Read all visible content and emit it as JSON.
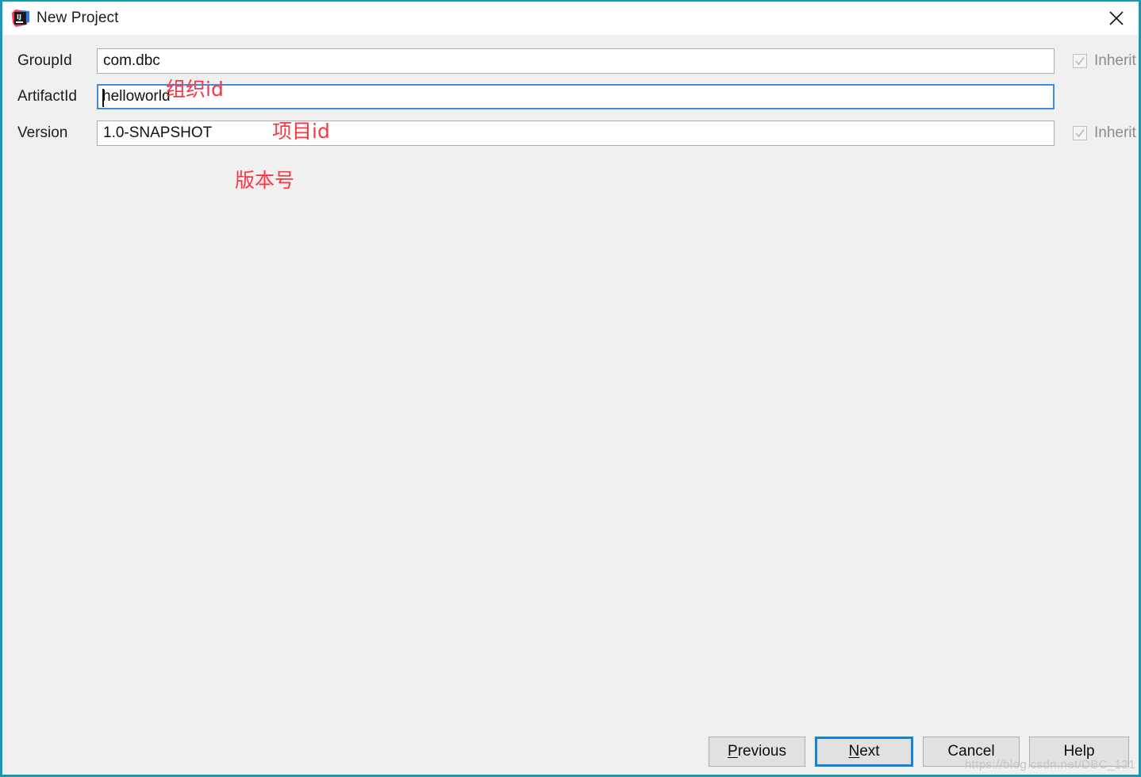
{
  "window": {
    "title": "New Project",
    "icon": "intellij-idea-icon",
    "close_icon": "close-icon",
    "border_color": "#1799b5",
    "titlebar_bg": "#ffffff",
    "content_bg": "#f0f0f0"
  },
  "form": {
    "rows": [
      {
        "label": "GroupId",
        "value": "com.dbc",
        "focused": false,
        "inherit": {
          "label": "Inherit",
          "checked": true,
          "enabled": false
        }
      },
      {
        "label": "ArtifactId",
        "value": "helloworld",
        "focused": true,
        "inherit": null
      },
      {
        "label": "Version",
        "value": "1.0-SNAPSHOT",
        "focused": false,
        "inherit": {
          "label": "Inherit",
          "checked": true,
          "enabled": false
        }
      }
    ]
  },
  "annotations": {
    "color": "#fb3640",
    "items": [
      {
        "text": "组织id",
        "target": "GroupId"
      },
      {
        "text": "项目id",
        "target": "ArtifactId"
      },
      {
        "text": "版本号",
        "target": "Version"
      }
    ]
  },
  "buttons": {
    "previous": {
      "label": "Previous",
      "mnemonic": "P",
      "default": false
    },
    "next": {
      "label": "Next",
      "mnemonic": "N",
      "default": true,
      "focus_color": "#1185da"
    },
    "cancel": {
      "label": "Cancel",
      "mnemonic": "",
      "default": false
    },
    "help": {
      "label": "Help",
      "mnemonic": "",
      "default": false
    }
  },
  "watermark": {
    "text": "https://blog.csdn.net/DBC_121"
  }
}
